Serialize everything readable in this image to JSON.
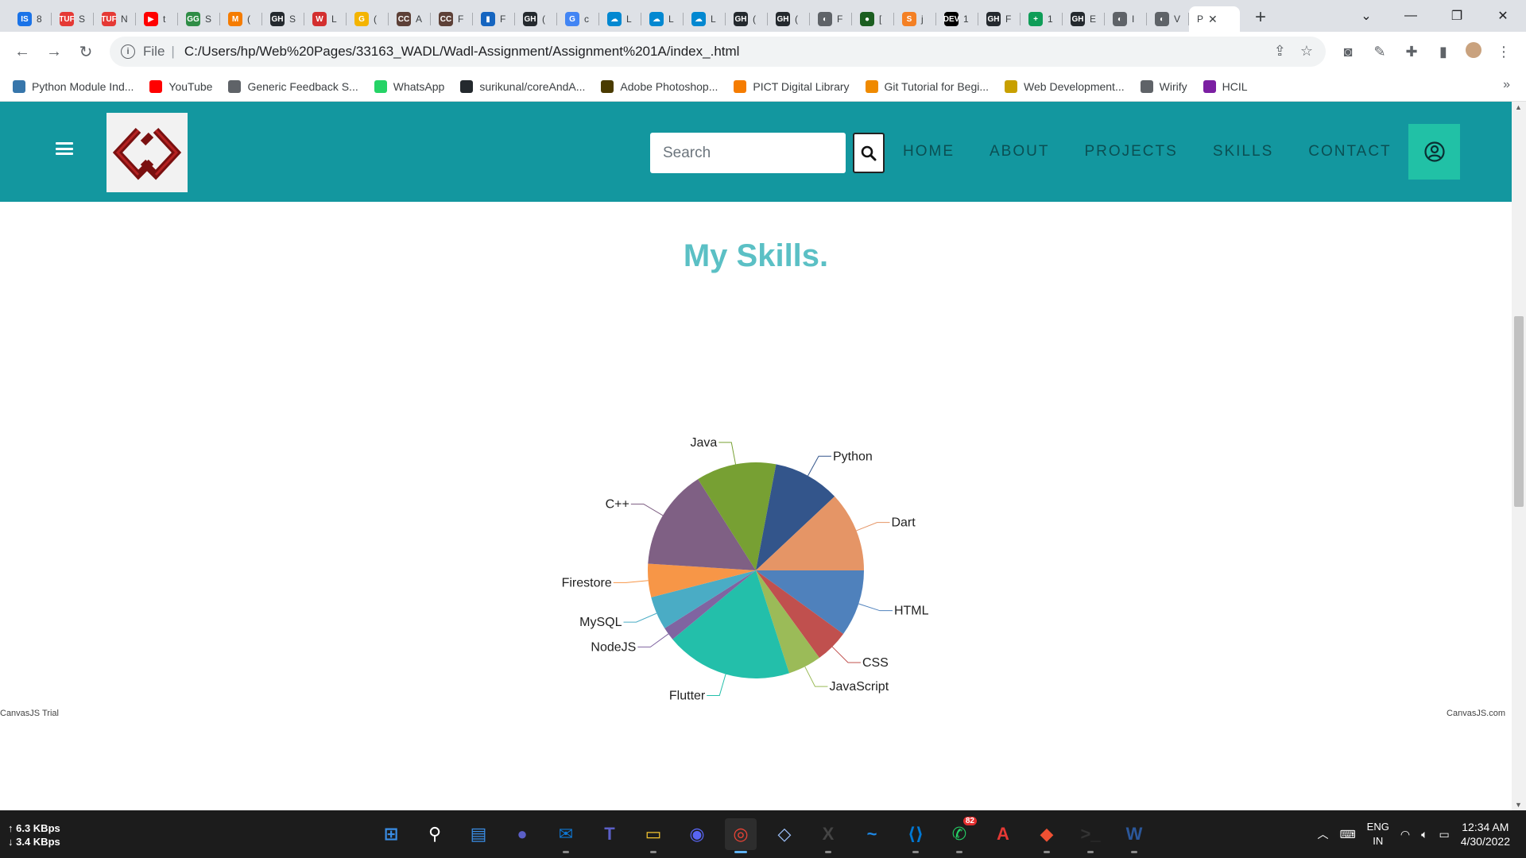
{
  "browser": {
    "tabs": [
      {
        "favicon": "IS",
        "initial": "8",
        "color": "#1a73e8"
      },
      {
        "favicon": "TUF",
        "initial": "S",
        "color": "#e53935"
      },
      {
        "favicon": "TUF",
        "initial": "N",
        "color": "#e53935"
      },
      {
        "favicon": "▶",
        "initial": "t",
        "color": "#ff0000"
      },
      {
        "favicon": "GG",
        "initial": "S",
        "color": "#2f8d46"
      },
      {
        "favicon": "M",
        "initial": "(",
        "color": "#f57c00"
      },
      {
        "favicon": "GH",
        "initial": "S",
        "color": "#24292e"
      },
      {
        "favicon": "W",
        "initial": "L",
        "color": "#d32f2f"
      },
      {
        "favicon": "G",
        "initial": "(",
        "color": "#f4b400"
      },
      {
        "favicon": "CC",
        "initial": "A",
        "color": "#5d4037"
      },
      {
        "favicon": "CC",
        "initial": "F",
        "color": "#5d4037"
      },
      {
        "favicon": "▮",
        "initial": "F",
        "color": "#1565c0"
      },
      {
        "favicon": "GH",
        "initial": "(",
        "color": "#24292e"
      },
      {
        "favicon": "G",
        "initial": "c",
        "color": "#4285f4"
      },
      {
        "favicon": "☁",
        "initial": "L",
        "color": "#0288d1"
      },
      {
        "favicon": "☁",
        "initial": "L",
        "color": "#0288d1"
      },
      {
        "favicon": "☁",
        "initial": "L",
        "color": "#0288d1"
      },
      {
        "favicon": "GH",
        "initial": "(",
        "color": "#24292e"
      },
      {
        "favicon": "GH",
        "initial": "(",
        "color": "#24292e"
      },
      {
        "favicon": "◐",
        "initial": "F",
        "color": "#5f6368"
      },
      {
        "favicon": "●",
        "initial": "[",
        "color": "#1b5e20"
      },
      {
        "favicon": "S",
        "initial": "j",
        "color": "#f48024"
      },
      {
        "favicon": "DEV",
        "initial": "1",
        "color": "#000000"
      },
      {
        "favicon": "GH",
        "initial": "F",
        "color": "#24292e"
      },
      {
        "favicon": "+",
        "initial": "1",
        "color": "#0f9d58"
      },
      {
        "favicon": "GH",
        "initial": "E",
        "color": "#24292e"
      },
      {
        "favicon": "◐",
        "initial": "I",
        "color": "#5f6368"
      },
      {
        "favicon": "◐",
        "initial": "V",
        "color": "#5f6368"
      }
    ],
    "active_tab_initial": "P",
    "url_prefix": "File",
    "url": "C:/Users/hp/Web%20Pages/33163_WADL/Wadl-Assignment/Assignment%201A/index_.html",
    "bookmarks": [
      {
        "label": "Python Module Ind...",
        "color": "#3776ab"
      },
      {
        "label": "YouTube",
        "color": "#ff0000"
      },
      {
        "label": "Generic Feedback S...",
        "color": "#5f6368"
      },
      {
        "label": "WhatsApp",
        "color": "#25d366"
      },
      {
        "label": "surikunal/coreAndA...",
        "color": "#24292e"
      },
      {
        "label": "Adobe Photoshop...",
        "color": "#4a3b00"
      },
      {
        "label": "PICT Digital Library",
        "color": "#f57c00"
      },
      {
        "label": "Git Tutorial for Begi...",
        "color": "#ef8a00"
      },
      {
        "label": "Web Development...",
        "color": "#c8a000"
      },
      {
        "label": "Wirify",
        "color": "#5f6368"
      },
      {
        "label": "HCIL",
        "color": "#7b1fa2"
      }
    ]
  },
  "site": {
    "search_placeholder": "Search",
    "nav": [
      "HOME",
      "ABOUT",
      "PROJECTS",
      "SKILLS",
      "CONTACT"
    ],
    "section_title": "My Skills.",
    "trial_label": "CanvasJS Trial",
    "credit_label": "CanvasJS.com"
  },
  "chart_data": {
    "type": "pie",
    "title": "",
    "slices": [
      {
        "label": "HTML",
        "value": 10,
        "color": "#4f81bc"
      },
      {
        "label": "CSS",
        "value": 5,
        "color": "#c0504e"
      },
      {
        "label": "JavaScript",
        "value": 5,
        "color": "#9bbb58"
      },
      {
        "label": "Flutter",
        "value": 19,
        "color": "#23bfaa"
      },
      {
        "label": "NodeJS",
        "value": 2,
        "color": "#8064a1"
      },
      {
        "label": "MySQL",
        "value": 5,
        "color": "#4aacc5"
      },
      {
        "label": "Firestore",
        "value": 5,
        "color": "#f79647"
      },
      {
        "label": "C++",
        "value": 15,
        "color": "#7f6084"
      },
      {
        "label": "Java",
        "value": 12,
        "color": "#77a033"
      },
      {
        "label": "Python",
        "value": 10,
        "color": "#33558b"
      },
      {
        "label": "Dart",
        "value": 12,
        "color": "#e59566"
      }
    ],
    "legend_position": "bottom"
  },
  "taskbar": {
    "net_up": "↑ 6.3 KBps",
    "net_down": "↓ 3.4 KBps",
    "apps": [
      {
        "name": "windows-start",
        "glyph": "⊞",
        "color": "#3a8ee6"
      },
      {
        "name": "search",
        "glyph": "⚲",
        "color": "#ffffff"
      },
      {
        "name": "widgets",
        "glyph": "▤",
        "color": "#3a8ee6"
      },
      {
        "name": "meet",
        "glyph": "●",
        "color": "#5b5fc7"
      },
      {
        "name": "mail",
        "glyph": "✉",
        "color": "#0f78d4"
      },
      {
        "name": "teams",
        "glyph": "T",
        "color": "#5b5fc7"
      },
      {
        "name": "file-explorer",
        "glyph": "▭",
        "color": "#f4c430"
      },
      {
        "name": "discord",
        "glyph": "◉",
        "color": "#5865f2"
      },
      {
        "name": "chrome",
        "glyph": "◎",
        "color": "#ea4335"
      },
      {
        "name": "3d-viewer",
        "glyph": "◇",
        "color": "#a0c4ff"
      },
      {
        "name": "mplab-x-ide",
        "glyph": "X",
        "color": "#444"
      },
      {
        "name": "whiteboard",
        "glyph": "~",
        "color": "#1e88e5"
      },
      {
        "name": "vscode",
        "glyph": "⟨⟩",
        "color": "#0078d4"
      },
      {
        "name": "whatsapp",
        "glyph": "✆",
        "color": "#25d366",
        "badge": "82"
      },
      {
        "name": "acrobat",
        "glyph": "A",
        "color": "#e53935"
      },
      {
        "name": "git",
        "glyph": "◆",
        "color": "#f05133"
      },
      {
        "name": "terminal",
        "glyph": ">_",
        "color": "#333"
      },
      {
        "name": "word",
        "glyph": "W",
        "color": "#2b579a"
      }
    ],
    "lang_top": "ENG",
    "lang_bottom": "IN",
    "time": "12:34 AM",
    "date": "4/30/2022"
  }
}
